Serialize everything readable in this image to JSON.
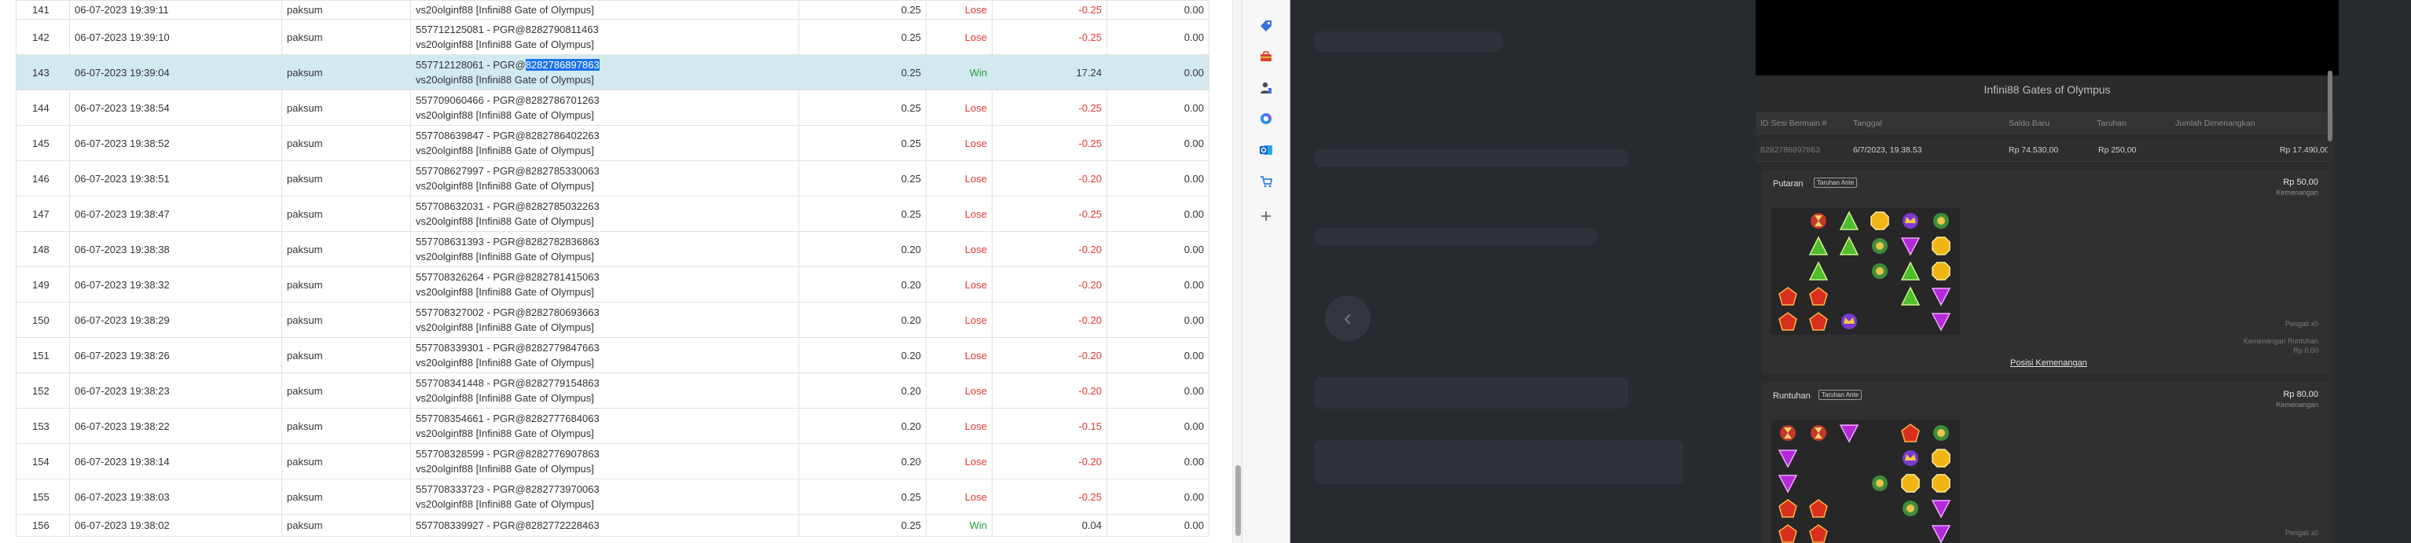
{
  "rows": [
    {
      "no": "141",
      "date": "06-07-2023 19:39:11",
      "user": "paksum",
      "tx_line1": "",
      "tx_pre": "",
      "tx_highlight": "",
      "tx_line2": "vs20olginf88 [Infini88 Gate of Olympus]",
      "bet": "0.25",
      "result": "Lose",
      "win": "-0.25",
      "balance": "0.00"
    },
    {
      "no": "142",
      "date": "06-07-2023 19:39:10",
      "user": "paksum",
      "tx_line1": "557712125081 - PGR@8282790811463",
      "tx_pre": "",
      "tx_highlight": "",
      "tx_line2": "vs20olginf88 [Infini88 Gate of Olympus]",
      "bet": "0.25",
      "result": "Lose",
      "win": "-0.25",
      "balance": "0.00"
    },
    {
      "no": "143",
      "date": "06-07-2023 19:39:04",
      "user": "paksum",
      "tx_line1": "",
      "tx_pre": "557712128061 - PGR@",
      "tx_highlight": "8282786897863",
      "tx_line2": "vs20olginf88 [Infini88 Gate of Olympus]",
      "bet": "0.25",
      "result": "Win",
      "win": "17.24",
      "balance": "0.00"
    },
    {
      "no": "144",
      "date": "06-07-2023 19:38:54",
      "user": "paksum",
      "tx_line1": "557709060466 - PGR@8282786701263",
      "tx_pre": "",
      "tx_highlight": "",
      "tx_line2": "vs20olginf88 [Infini88 Gate of Olympus]",
      "bet": "0.25",
      "result": "Lose",
      "win": "-0.25",
      "balance": "0.00"
    },
    {
      "no": "145",
      "date": "06-07-2023 19:38:52",
      "user": "paksum",
      "tx_line1": "557708639847 - PGR@8282786402263",
      "tx_pre": "",
      "tx_highlight": "",
      "tx_line2": "vs20olginf88 [Infini88 Gate of Olympus]",
      "bet": "0.25",
      "result": "Lose",
      "win": "-0.25",
      "balance": "0.00"
    },
    {
      "no": "146",
      "date": "06-07-2023 19:38:51",
      "user": "paksum",
      "tx_line1": "557708627997 - PGR@8282785330063",
      "tx_pre": "",
      "tx_highlight": "",
      "tx_line2": "vs20olginf88 [Infini88 Gate of Olympus]",
      "bet": "0.25",
      "result": "Lose",
      "win": "-0.20",
      "balance": "0.00"
    },
    {
      "no": "147",
      "date": "06-07-2023 19:38:47",
      "user": "paksum",
      "tx_line1": "557708632031 - PGR@8282785032263",
      "tx_pre": "",
      "tx_highlight": "",
      "tx_line2": "vs20olginf88 [Infini88 Gate of Olympus]",
      "bet": "0.25",
      "result": "Lose",
      "win": "-0.25",
      "balance": "0.00"
    },
    {
      "no": "148",
      "date": "06-07-2023 19:38:38",
      "user": "paksum",
      "tx_line1": "557708631393 - PGR@8282782836863",
      "tx_pre": "",
      "tx_highlight": "",
      "tx_line2": "vs20olginf88 [Infini88 Gate of Olympus]",
      "bet": "0.20",
      "result": "Lose",
      "win": "-0.20",
      "balance": "0.00"
    },
    {
      "no": "149",
      "date": "06-07-2023 19:38:32",
      "user": "paksum",
      "tx_line1": "557708326264 - PGR@8282781415063",
      "tx_pre": "",
      "tx_highlight": "",
      "tx_line2": "vs20olginf88 [Infini88 Gate of Olympus]",
      "bet": "0.20",
      "result": "Lose",
      "win": "-0.20",
      "balance": "0.00"
    },
    {
      "no": "150",
      "date": "06-07-2023 19:38:29",
      "user": "paksum",
      "tx_line1": "557708327002 - PGR@8282780693663",
      "tx_pre": "",
      "tx_highlight": "",
      "tx_line2": "vs20olginf88 [Infini88 Gate of Olympus]",
      "bet": "0.20",
      "result": "Lose",
      "win": "-0.20",
      "balance": "0.00"
    },
    {
      "no": "151",
      "date": "06-07-2023 19:38:26",
      "user": "paksum",
      "tx_line1": "557708339301 - PGR@8282779847663",
      "tx_pre": "",
      "tx_highlight": "",
      "tx_line2": "vs20olginf88 [Infini88 Gate of Olympus]",
      "bet": "0.20",
      "result": "Lose",
      "win": "-0.20",
      "balance": "0.00"
    },
    {
      "no": "152",
      "date": "06-07-2023 19:38:23",
      "user": "paksum",
      "tx_line1": "557708341448 - PGR@8282779154863",
      "tx_pre": "",
      "tx_highlight": "",
      "tx_line2": "vs20olginf88 [Infini88 Gate of Olympus]",
      "bet": "0.20",
      "result": "Lose",
      "win": "-0.20",
      "balance": "0.00"
    },
    {
      "no": "153",
      "date": "06-07-2023 19:38:22",
      "user": "paksum",
      "tx_line1": "557708354661 - PGR@8282777684063",
      "tx_pre": "",
      "tx_highlight": "",
      "tx_line2": "vs20olginf88 [Infini88 Gate of Olympus]",
      "bet": "0.20",
      "result": "Lose",
      "win": "-0.15",
      "balance": "0.00"
    },
    {
      "no": "154",
      "date": "06-07-2023 19:38:14",
      "user": "paksum",
      "tx_line1": "557708328599 - PGR@8282776907863",
      "tx_pre": "",
      "tx_highlight": "",
      "tx_line2": "vs20olginf88 [Infini88 Gate of Olympus]",
      "bet": "0.20",
      "result": "Lose",
      "win": "-0.20",
      "balance": "0.00"
    },
    {
      "no": "155",
      "date": "06-07-2023 19:38:03",
      "user": "paksum",
      "tx_line1": "557708333723 - PGR@8282773970063",
      "tx_pre": "",
      "tx_highlight": "",
      "tx_line2": "vs20olginf88 [Infini88 Gate of Olympus]",
      "bet": "0.25",
      "result": "Lose",
      "win": "-0.25",
      "balance": "0.00"
    },
    {
      "no": "156",
      "date": "06-07-2023 19:38:02",
      "user": "paksum",
      "tx_line1": "557708339927 - PGR@8282772228463",
      "tx_pre": "",
      "tx_highlight": "",
      "tx_line2": "",
      "bet": "0.25",
      "result": "Win",
      "win": "0.04",
      "balance": "0.00"
    }
  ],
  "side_panel": {
    "icons": [
      "tag-icon",
      "toolbox-icon",
      "user-chess-icon",
      "copilot-icon",
      "outlook-icon",
      "shopping-icon",
      "add-icon"
    ]
  },
  "modal": {
    "title": "Infini88 Gates of Olympus",
    "columns": [
      "ID Sesi Bermain #",
      "Tanggal",
      "Saldo Baru",
      "Taruhan",
      "Jumlah Dimenangkan"
    ],
    "summary": [
      "8282786897863",
      "6/7/2023, 19.38.53",
      "Rp 74.530,00",
      "Rp 250,00",
      "Rp 17.490,00"
    ],
    "round1": {
      "label": "Putaran",
      "badge": "Taruhan Ante",
      "amount": "Rp 50,00",
      "sub": "Kemenangan",
      "note1": "Pengali x0",
      "note2": "Kemenangan Runtuhan",
      "note3": "Rp 0,00",
      "link": "Posisi Kemenangan"
    },
    "round2": {
      "label": "Runtuhan",
      "badge": "Taruhan Ante",
      "amount": "Rp 80,00",
      "sub": "Kemenangan",
      "note1": "Pengali x0"
    }
  },
  "colors": {
    "lose": "#e53935",
    "win": "#22a33a",
    "selected_row": "#d3e9f0",
    "highlight": "#1a73e8",
    "overlay": "#262b30"
  }
}
